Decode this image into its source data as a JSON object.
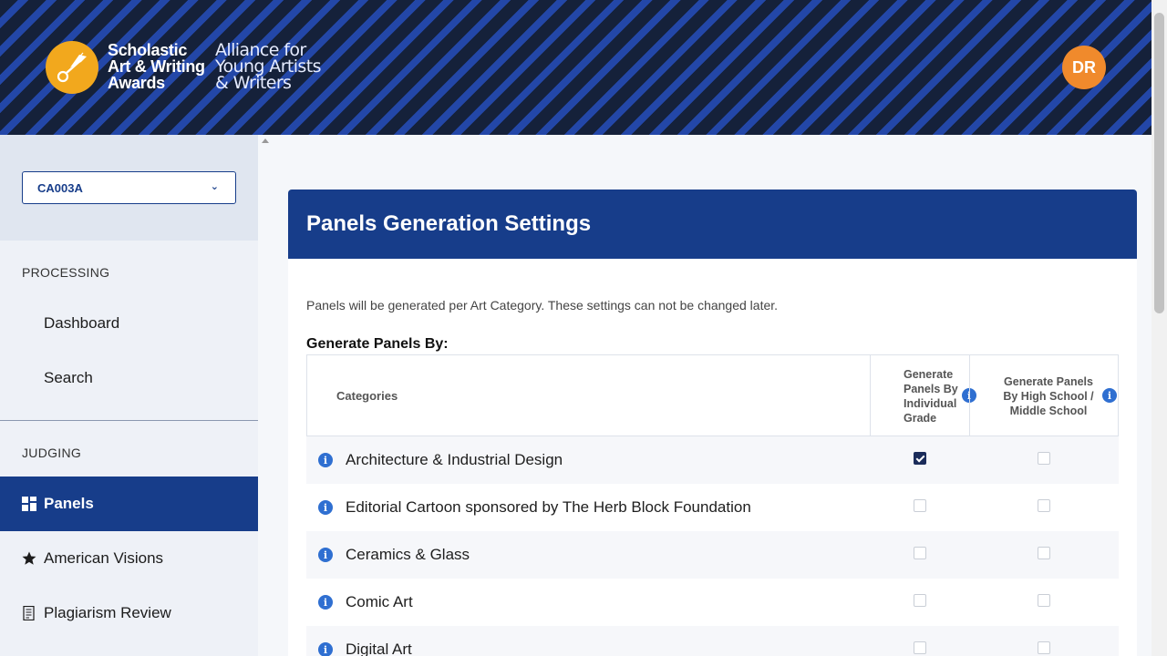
{
  "header": {
    "logo_text": [
      "Scholastic",
      "Art & Writing",
      "Awards"
    ],
    "logo_sub": [
      "Alliance for",
      "Young Artists",
      "& Writers"
    ],
    "avatar_initials": "DR"
  },
  "sidebar": {
    "selector_value": "CA003A",
    "processing_label": "PROCESSING",
    "judging_label": "JUDGING",
    "items": [
      {
        "label": "Dashboard",
        "icon": null
      },
      {
        "label": "Search",
        "icon": null
      },
      {
        "label": "Panels",
        "icon": "grid-icon",
        "active": true
      },
      {
        "label": "American Visions",
        "icon": "star-icon"
      },
      {
        "label": "Plagiarism Review",
        "icon": "document-icon"
      }
    ]
  },
  "main": {
    "title": "Panels Generation Settings",
    "description": "Panels will be generated per Art Category. These settings can not be changed later.",
    "generate_by_label": "Generate Panels By:",
    "table": {
      "col_categories": "Categories",
      "col_individual_grade": [
        "Generate",
        "Panels By",
        "Individual",
        "Grade"
      ],
      "col_school_level": [
        "Generate Panels",
        "By High School /",
        "Middle School"
      ],
      "rows": [
        {
          "category": "Architecture & Industrial Design",
          "individual_grade": true,
          "school_level": false
        },
        {
          "category": "Editorial Cartoon sponsored by The Herb Block Foundation",
          "individual_grade": false,
          "school_level": false
        },
        {
          "category": "Ceramics & Glass",
          "individual_grade": false,
          "school_level": false
        },
        {
          "category": "Comic Art",
          "individual_grade": false,
          "school_level": false
        },
        {
          "category": "Digital Art",
          "individual_grade": false,
          "school_level": false
        }
      ]
    }
  },
  "colors": {
    "primary": "#173d8a",
    "accent_orange": "#f08a2c",
    "logo_gold": "#f2a81d"
  }
}
